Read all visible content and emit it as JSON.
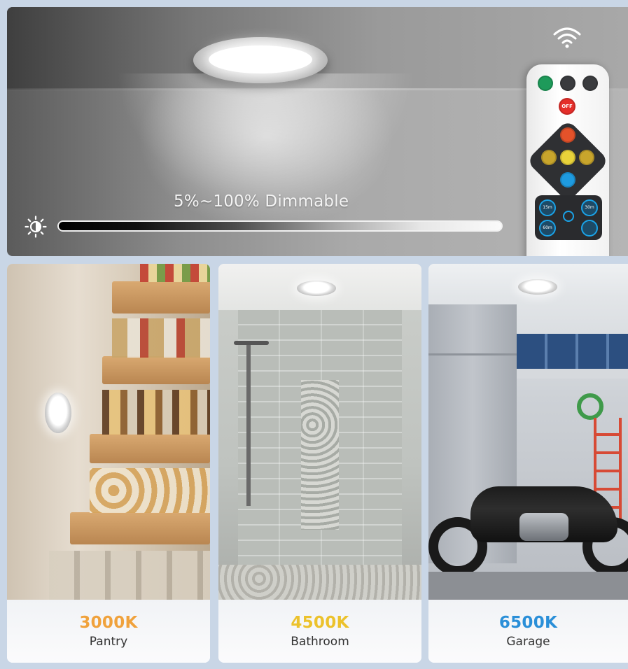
{
  "hero": {
    "dimmable_label": "5%~100% Dimmable",
    "brightness_icon": "sun-brightness-icon",
    "signal_icon": "wifi-signal-icon",
    "remote": {
      "off_label": "OFF",
      "timer_15": "15m",
      "timer_30": "30m",
      "timer_60": "60m"
    }
  },
  "cards": [
    {
      "temperature": "3000K",
      "room": "Pantry",
      "color": "#f0a23c"
    },
    {
      "temperature": "4500K",
      "room": "Bathroom",
      "color": "#ecc22c"
    },
    {
      "temperature": "6500K",
      "room": "Garage",
      "color": "#2a8fd8"
    }
  ]
}
